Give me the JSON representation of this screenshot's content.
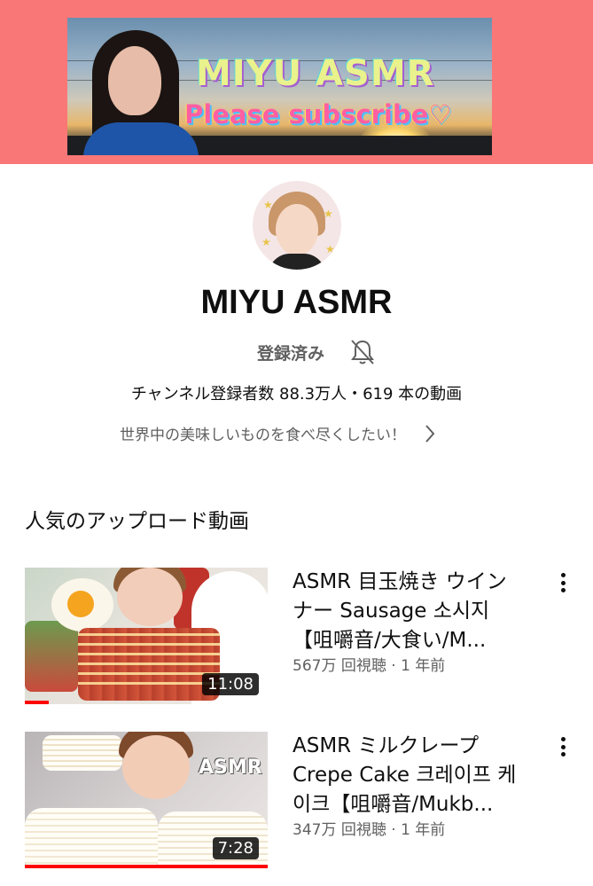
{
  "banner": {
    "title": "MIYU ASMR",
    "subtitle": "Please subscribe♡",
    "background_color": "#fa7777"
  },
  "channel": {
    "name": "MIYU ASMR",
    "subscribed_label": "登録済み",
    "bell_icon": "notifications-off-icon",
    "stats": "チャンネル登録者数 88.3万人・619 本の動画",
    "description": "世界中の美味しいものを食べ尽くしたい！",
    "description_chevron": "chevron-right-icon"
  },
  "popular_section": {
    "title": "人気のアップロード動画",
    "videos": [
      {
        "title": "ASMR 目玉焼き ウインナー Sausage 소시지【咀嚼音/大食い/M...",
        "meta": "567万 回視聴 · 1 年前",
        "duration": "11:08",
        "watched_fraction": 0.1
      },
      {
        "title": "ASMR ミルクレープ Crepe Cake 크레이프 케이크【咀嚼音/Mukb...",
        "meta": "347万 回視聴 · 1 年前",
        "duration": "7:28",
        "watched_fraction": 1.0
      }
    ]
  },
  "colors": {
    "accent_red": "#ff0000",
    "text_primary": "#0f0f0f",
    "text_secondary": "#606060"
  }
}
